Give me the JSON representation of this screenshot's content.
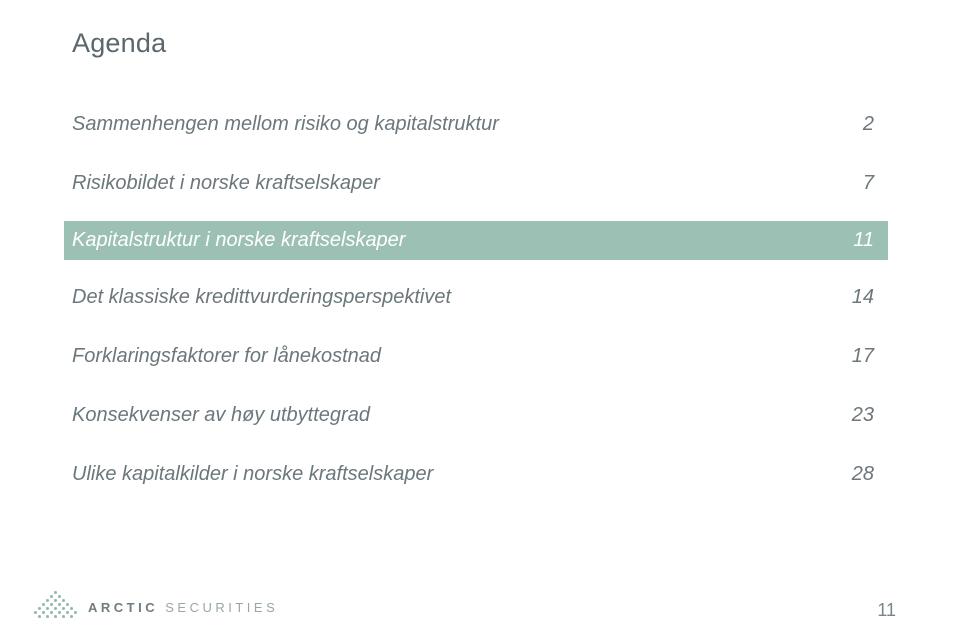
{
  "title": "Agenda",
  "agenda": [
    {
      "label": "Sammenhengen mellom risiko og kapitalstruktur",
      "page": "2",
      "highlight": false
    },
    {
      "label": "Risikobildet i norske kraftselskaper",
      "page": "7",
      "highlight": false
    },
    {
      "label": "Kapitalstruktur i norske kraftselskaper",
      "page": "11",
      "highlight": true
    },
    {
      "label": "Det klassiske kredittvurderingsperspektivet",
      "page": "14",
      "highlight": false
    },
    {
      "label": "Forklaringsfaktorer for lånekostnad",
      "page": "17",
      "highlight": false
    },
    {
      "label": "Konsekvenser av høy utbyttegrad",
      "page": "23",
      "highlight": false
    },
    {
      "label": "Ulike kapitalkilder i norske kraftselskaper",
      "page": "28",
      "highlight": false
    }
  ],
  "brand": {
    "bold": "ARCTIC",
    "light": "SECURITIES"
  },
  "page_number": "11"
}
